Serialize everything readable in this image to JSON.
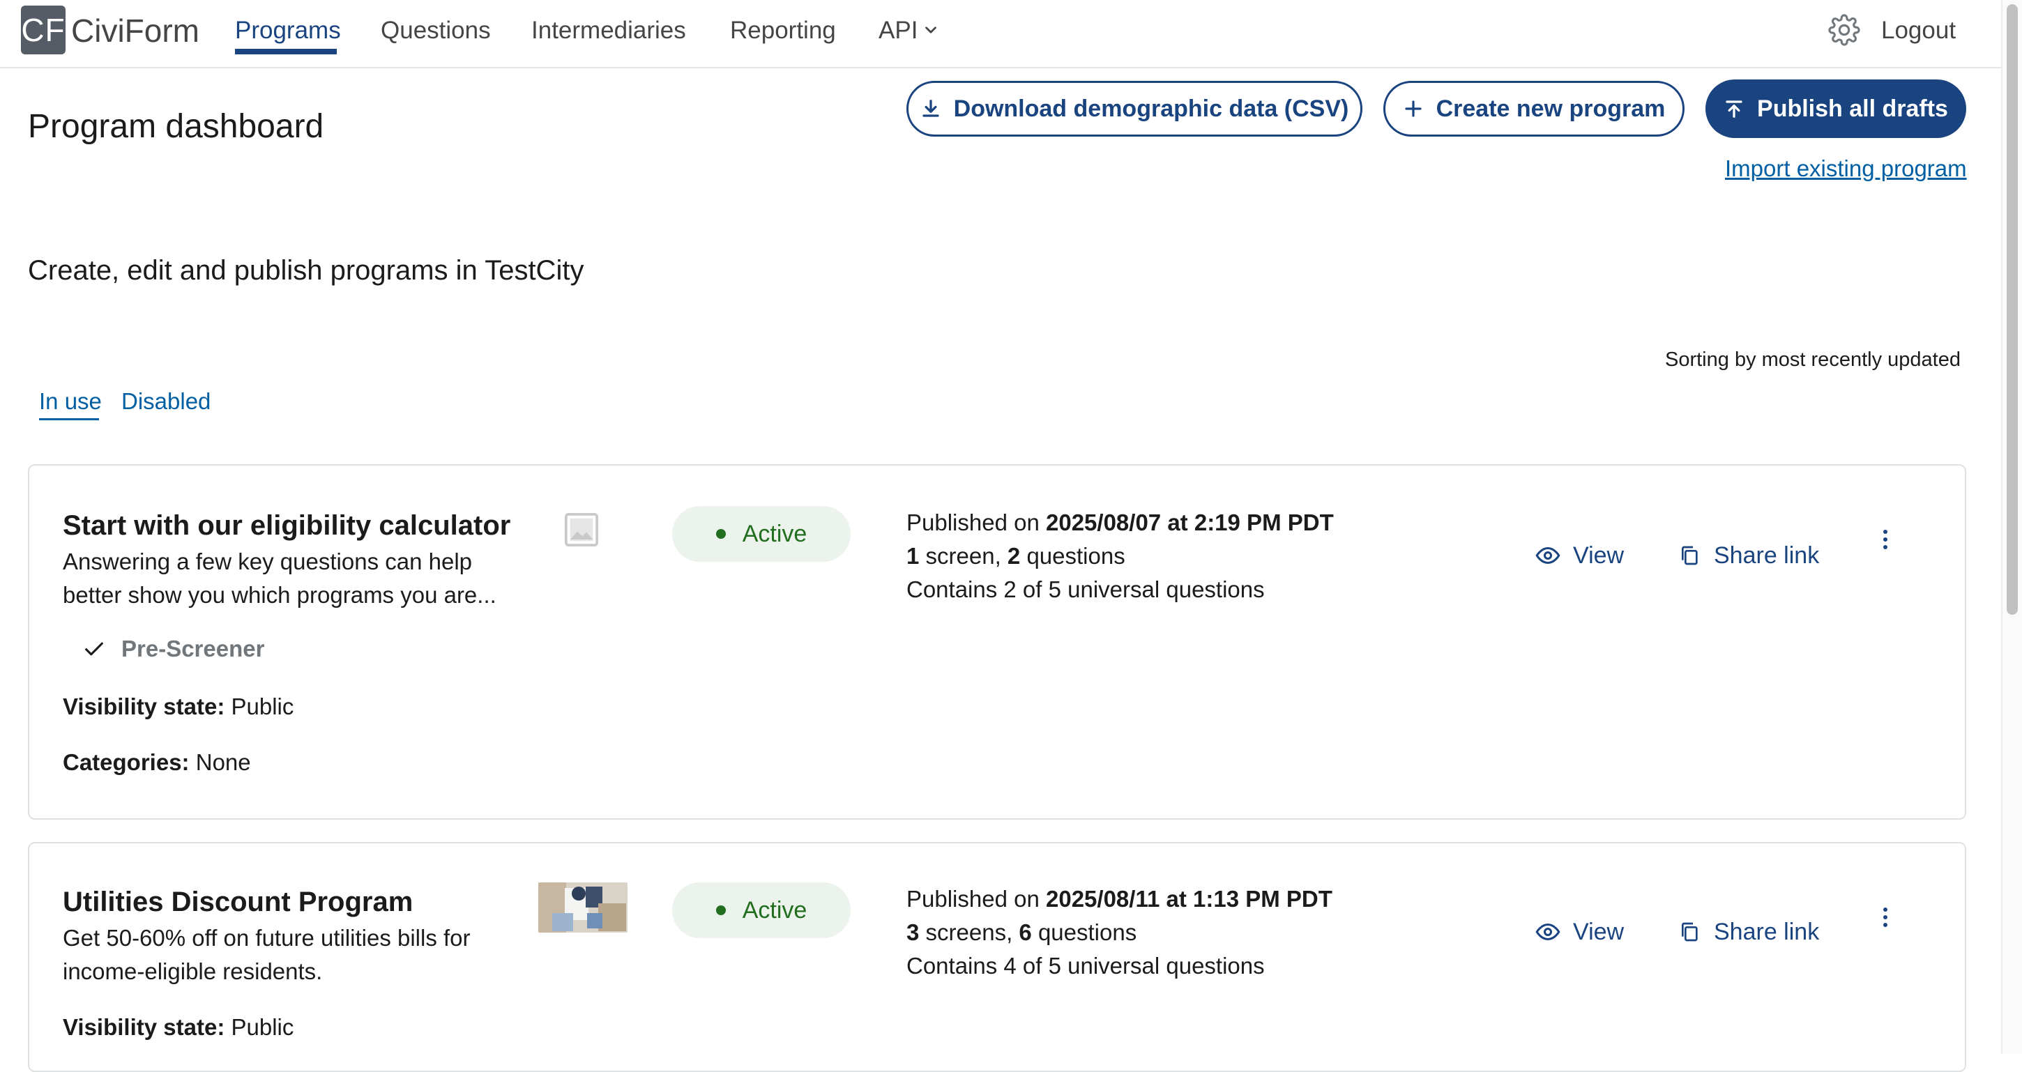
{
  "app": {
    "logo_mark": "CF",
    "logo_name": "CiviForm"
  },
  "nav": {
    "items": [
      "Programs",
      "Questions",
      "Intermediaries",
      "Reporting",
      "API"
    ],
    "active": "Programs",
    "settings_icon": "gear-icon",
    "logout_label": "Logout"
  },
  "page": {
    "title": "Program dashboard",
    "subtitle": "Create, edit and publish programs in TestCity",
    "sorting_note": "Sorting by most recently updated"
  },
  "toolbar": {
    "download_label": "Download demographic data (CSV)",
    "create_label": "Create new program",
    "publish_label": "Publish all drafts",
    "import_label": "Import existing program"
  },
  "tabs": {
    "in_use": "In use",
    "disabled": "Disabled",
    "active": "In use"
  },
  "programs": [
    {
      "title": "Start with our eligibility calculator",
      "description_line1": "Answering a few key questions can help",
      "description_line2": "better show you which programs you are...",
      "image": "image-placeholder-icon",
      "status": "Active",
      "published_prefix": "Published on",
      "published_date": "2025/08/07 at 2:19 PM PDT",
      "screens_count": "1",
      "screens_word": "screen,",
      "questions_count": "2",
      "questions_word": "questions",
      "universal": "Contains 2 of 5 universal questions",
      "prescreener_label": "Pre-Screener",
      "visibility_label": "Visibility state:",
      "visibility_value": "Public",
      "categories_label": "Categories:",
      "categories_value": "None",
      "view_label": "View",
      "share_label": "Share link"
    },
    {
      "title": "Utilities Discount Program",
      "description_line1": "Get 50-60% off on future utilities bills for",
      "description_line2": "income-eligible residents.",
      "image": "program-photo",
      "status": "Active",
      "published_prefix": "Published on",
      "published_date": "2025/08/11 at 1:13 PM PDT",
      "screens_count": "3",
      "screens_word": "screens,",
      "questions_count": "6",
      "questions_word": "questions",
      "universal": "Contains 4 of 5 universal questions",
      "visibility_label": "Visibility state:",
      "visibility_value": "Public",
      "view_label": "View",
      "share_label": "Share link"
    }
  ],
  "colors": {
    "primary": "#1a4480",
    "link": "#005ea2",
    "success_bg": "#ecf3ec",
    "success_text": "#216e1f"
  }
}
